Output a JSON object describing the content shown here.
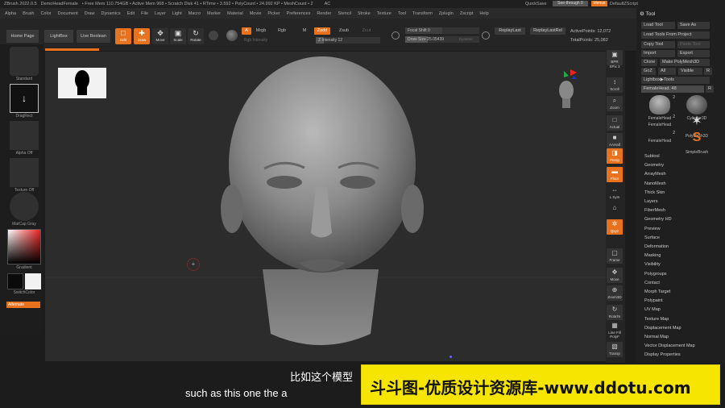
{
  "titlebar": {
    "items": [
      "ZBrush 2022.0.5",
      "DemoHeadFemale",
      "• Free Mem 110.754GB • Active Mem 968 • Scratch Disk 41 • RTime • 3.592 • PolyCount • 24.992 KP • MeshCount • 2",
      "AC"
    ],
    "quicksave": "QuickSave",
    "seethrough": "See-through 0",
    "menus": "Menus",
    "script": "DefaultZScript"
  },
  "menubar": [
    "Alpha",
    "Brush",
    "Color",
    "Document",
    "Draw",
    "Dynamics",
    "Edit",
    "File",
    "Layer",
    "Light",
    "Macro",
    "Marker",
    "Material",
    "Movie",
    "Picker",
    "Preferences",
    "Render",
    "Stencil",
    "Stroke",
    "Texture",
    "Tool",
    "Transform",
    "Zplugin",
    "Zscript",
    "Help"
  ],
  "toprow": {
    "home": "Home Page",
    "lightbox": "LightBox",
    "liveboolean": "Live Boolean",
    "edit": "Edit",
    "draw": "Draw",
    "move": "Move",
    "scale": "Scale",
    "rotate": "Rotate",
    "a": "A",
    "mrgb": "Mrgb",
    "rgb": "Rgb",
    "m": "M",
    "zadd": "Zadd",
    "zsub": "Zsub",
    "zcut": "Zcut",
    "rgb_intensity": "Rgb Intensity",
    "z_intensity": "Z Intensity 12",
    "focal_shift": "Focal Shift 0",
    "draw_size": "Draw Size 25.05439",
    "dynamic": "Dynamic",
    "replay_last": "ReplayLast",
    "replay_last_rel": "ReplayLastRel",
    "active_points": "ActivePoints: 12,072",
    "total_points": "TotalPoints: 25,082"
  },
  "leftshelf": {
    "brush": "Standard",
    "stroke": "DragRect",
    "alpha": "Alpha Off",
    "texture": "Texture Off",
    "material": "MatCap Gray",
    "gradient": "Gradient",
    "switchcolor": "SwitchColor",
    "alternate": "Alternate"
  },
  "rightshelf": [
    {
      "icon": "bpr-icon",
      "label": "BPR",
      "style": "g"
    },
    {
      "icon": "spix-icon",
      "label": "SPix 3",
      "style": "t"
    },
    {
      "icon": "scroll-icon",
      "label": "Scroll",
      "style": "g"
    },
    {
      "icon": "zoom-icon",
      "label": "Zoom",
      "style": "g"
    },
    {
      "icon": "actual-icon",
      "label": "Actual",
      "style": "g"
    },
    {
      "icon": "aahalf-icon",
      "label": "AAHalf",
      "style": "g"
    },
    {
      "icon": "persp-icon",
      "label": "Persp",
      "style": "o"
    },
    {
      "icon": "floor-icon",
      "label": "Floor",
      "style": "o"
    },
    {
      "icon": "lsym-icon",
      "label": "L.Sym",
      "style": "t"
    },
    {
      "icon": "lock-icon",
      "label": "",
      "style": "t"
    },
    {
      "icon": "xyz-icon",
      "label": "Qxyz",
      "style": "o"
    },
    {
      "icon": "frame-icon",
      "label": "Frame",
      "style": "g"
    },
    {
      "icon": "move-icon",
      "label": "Move",
      "style": "g"
    },
    {
      "icon": "zoom3d-icon",
      "label": "Zoom3D",
      "style": "g"
    },
    {
      "icon": "rotate-icon",
      "label": "RotaTe",
      "style": "g"
    },
    {
      "icon": "linefill-icon",
      "label": "Line Fill PolyF",
      "style": "t"
    },
    {
      "icon": "transp-icon",
      "label": "Transp",
      "style": "g"
    }
  ],
  "tool": {
    "title": "Tool",
    "load_tool": "Load Tool",
    "save_as": "Save As",
    "load_project": "Load Tools From Project",
    "copy_tool": "Copy Tool",
    "paste_tool": "Paste Tool",
    "import": "Import",
    "export": "Export",
    "clone": "Clone",
    "make_polymesh": "Make PolyMesh3D",
    "goz": "GoZ",
    "all": "All",
    "visible": "Visible",
    "r": "R",
    "lightbox_tools": "Lightbox▶Tools",
    "female_head": "FemaleHead. 48",
    "r2": "R",
    "meshes": [
      {
        "label": "FemaleHead",
        "num": "2"
      },
      {
        "label": "Cylinder3D",
        "num": ""
      },
      {
        "label": "FemaleHead",
        "num": "2"
      },
      {
        "label": "PolyMesh3D",
        "num": ""
      },
      {
        "label": "FemaleHead",
        "num": "2"
      },
      {
        "label": "SimpleBrush",
        "num": ""
      }
    ],
    "subpalettes": [
      "Subtool",
      "Geometry",
      "ArrayMesh",
      "NanoMesh",
      "Thick Skin",
      "Layers",
      "FiberMesh",
      "Geometry HD",
      "Preview",
      "Surface",
      "Deformation",
      "Masking",
      "Visibility",
      "Polygroups",
      "Contact",
      "Morph Target",
      "Polypaint",
      "UV Map",
      "Texture Map",
      "Displacement Map",
      "Normal Map",
      "Vector Displacement Map",
      "Display Properties"
    ]
  },
  "subtitles": {
    "cn": "比如这个模型",
    "en": "such as this one the a"
  },
  "watermark": "斗斗图-优质设计资源库-www.ddotu.com"
}
